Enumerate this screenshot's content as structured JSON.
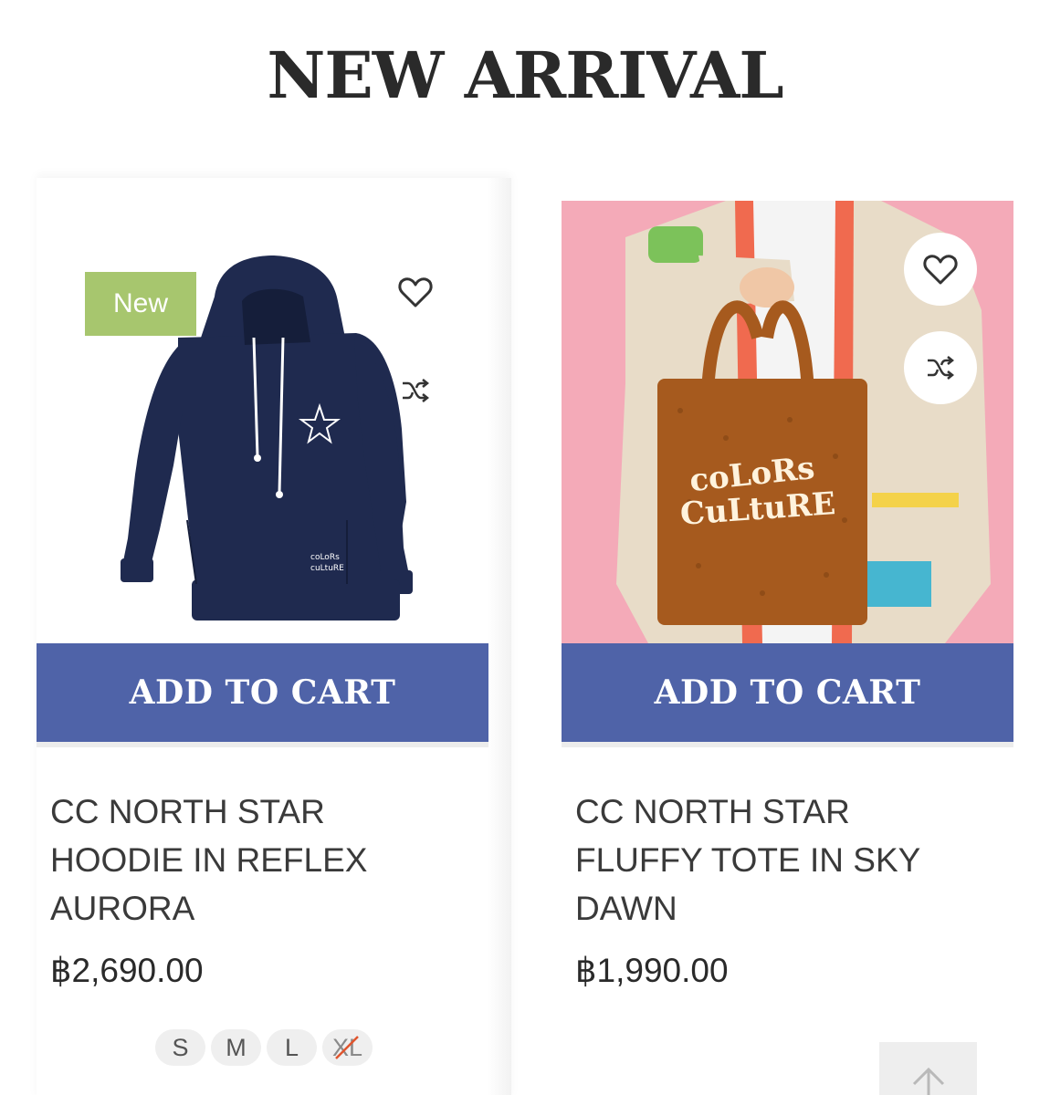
{
  "section": {
    "title": "NEW ARRIVAL"
  },
  "products": [
    {
      "badge": "New",
      "image_alt": "Navy hoodie",
      "add_to_cart_label": "ADD TO CART",
      "name": "CC NORTH STAR HOODIE IN REFLEX AURORA",
      "price": "฿2,690.00",
      "sizes": [
        "S",
        "M",
        "L",
        "XL"
      ],
      "sizes_unavailable": [
        "XL"
      ]
    },
    {
      "image_alt": "Person holding brown fluffy tote",
      "add_to_cart_label": "ADD TO CART",
      "name": "CC NORTH STAR FLUFFY TOTE IN SKY DAWN",
      "price": "฿1,990.00",
      "tote_print_line1": "coLoRs",
      "tote_print_line2": "CuLtuRE"
    }
  ],
  "icons": {
    "wishlist": "heart-icon",
    "compare": "shuffle-icon",
    "scroll_top": "arrow-up-icon"
  },
  "colors": {
    "accent": "#4f63a8",
    "badge_new": "#a7c66e",
    "pink_bg": "#f4aab8"
  }
}
